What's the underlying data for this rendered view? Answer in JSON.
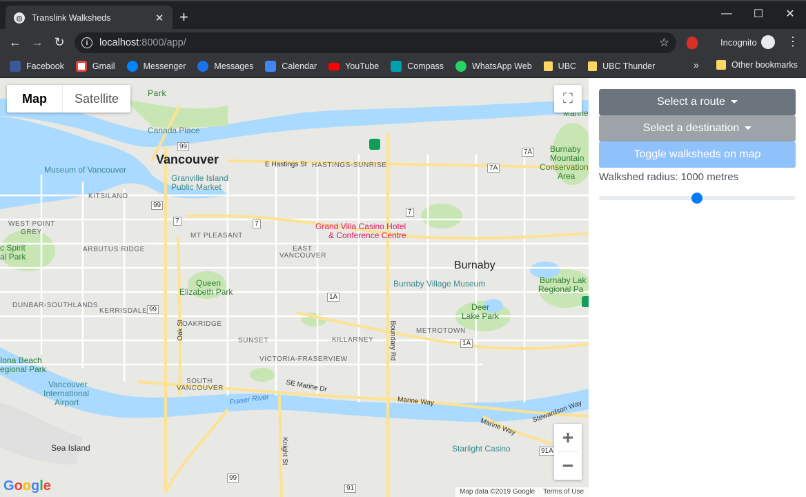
{
  "browser": {
    "tab_title": "Translink Walksheds",
    "url_host": "localhost",
    "url_path": ":8000/app/",
    "incognito_label": "Incognito",
    "bookmarks": [
      {
        "label": "Facebook",
        "color": "#3b5998"
      },
      {
        "label": "Gmail",
        "color": "#ea4335"
      },
      {
        "label": "Messenger",
        "color": "#0084ff"
      },
      {
        "label": "Messages",
        "color": "#1a73e8"
      },
      {
        "label": "Calendar",
        "color": "#4285f4"
      },
      {
        "label": "YouTube",
        "color": "#ff0000"
      },
      {
        "label": "Compass",
        "color": "#00a0b0"
      },
      {
        "label": "WhatsApp Web",
        "color": "#25d366"
      },
      {
        "label": "UBC",
        "color": "#fdd663"
      },
      {
        "label": "UBC Thunder",
        "color": "#fdd663"
      }
    ],
    "other_bookmarks": "Other bookmarks"
  },
  "map": {
    "type_map": "Map",
    "type_satellite": "Satellite",
    "zoom_in": "+",
    "zoom_out": "−",
    "google_logo": "Google",
    "map_data": "Map data ©2019 Google",
    "terms": "Terms of Use",
    "labels": {
      "vancouver": "Vancouver",
      "burnaby": "Burnaby",
      "canada_place": "Canada Place",
      "museum_vancouver": "Museum of Vancouver",
      "granville_1": "Granville Island",
      "granville_2": "Public Market",
      "kitsilano": "KITSILANO",
      "west_point_1": "WEST POINT",
      "west_point_2": "GREY",
      "arbutus": "ARBUTUS RIDGE",
      "mt_pleasant": "MT PLEASANT",
      "east_van_1": "EAST",
      "east_van_2": "VANCOUVER",
      "queen_1": "Queen",
      "queen_2": "Elizabeth Park",
      "dunbar": "DUNBAR-SOUTHLANDS",
      "kerrisdale": "KERRISDALE",
      "oakridge": "OAKRIDGE",
      "sunset": "SUNSET",
      "killarney": "KILLARNEY",
      "metrotown": "METROTOWN",
      "victoria": "VICTORIA-FRASERVIEW",
      "south_van_1": "SOUTH",
      "south_van_2": "VANCOUVER",
      "hastings": "E Hastings St",
      "hastings_sunrise": "HASTINGS-SUNRISE",
      "casino_1": "Grand Villa Casino Hotel",
      "casino_2": "& Conference Centre",
      "burnaby_village": "Burnaby Village Museum",
      "deer_1": "Deer",
      "deer_2": "Lake Park",
      "burnaby_lake_1": "Burnaby Lak",
      "burnaby_lake_2": "Regional Pa",
      "burnaby_mtn_1": "Burnaby",
      "burnaby_mtn_2": "Mountain",
      "burnaby_mtn_3": "Conservation",
      "burnaby_mtn_4": "Area",
      "park_top": "Park",
      "spirit_1": "c Spirit",
      "spirit_2": "al Park",
      "iona_1": "Iona Beach",
      "iona_2": "egional Park",
      "airport_1": "Vancouver",
      "airport_2": "International",
      "airport_3": "Airport",
      "sea_island": "Sea Island",
      "fraser": "Fraser River",
      "se_marine": "SE Marine Dr",
      "marine_way": "Marine Way",
      "marine_way_2": "Marine Way",
      "stewardson": "Stewardson Way",
      "starlight": "Starlight Casino",
      "marine_right": "Marine",
      "oak_st": "Oak St",
      "boundary": "Boundary Rd",
      "knight": "Knight St",
      "hwy_99a": "99",
      "hwy_99b": "99",
      "hwy_99c": "99",
      "hwy_99d": "99",
      "hwy_7a": "7",
      "hwy_7b": "7",
      "hwy_7c": "7",
      "hwy_7a_e": "7A",
      "hwy_7a_f": "7A",
      "hwy_1a_a": "1A",
      "hwy_1a_b": "1A",
      "hwy_91a": "91A",
      "hwy_91": "91"
    }
  },
  "panel": {
    "route_button": "Select a route",
    "destination_button": "Select a destination",
    "toggle_button": "Toggle walksheds on map",
    "radius_label": "Walkshed radius: 1000 metres",
    "radius_value": 1000
  }
}
